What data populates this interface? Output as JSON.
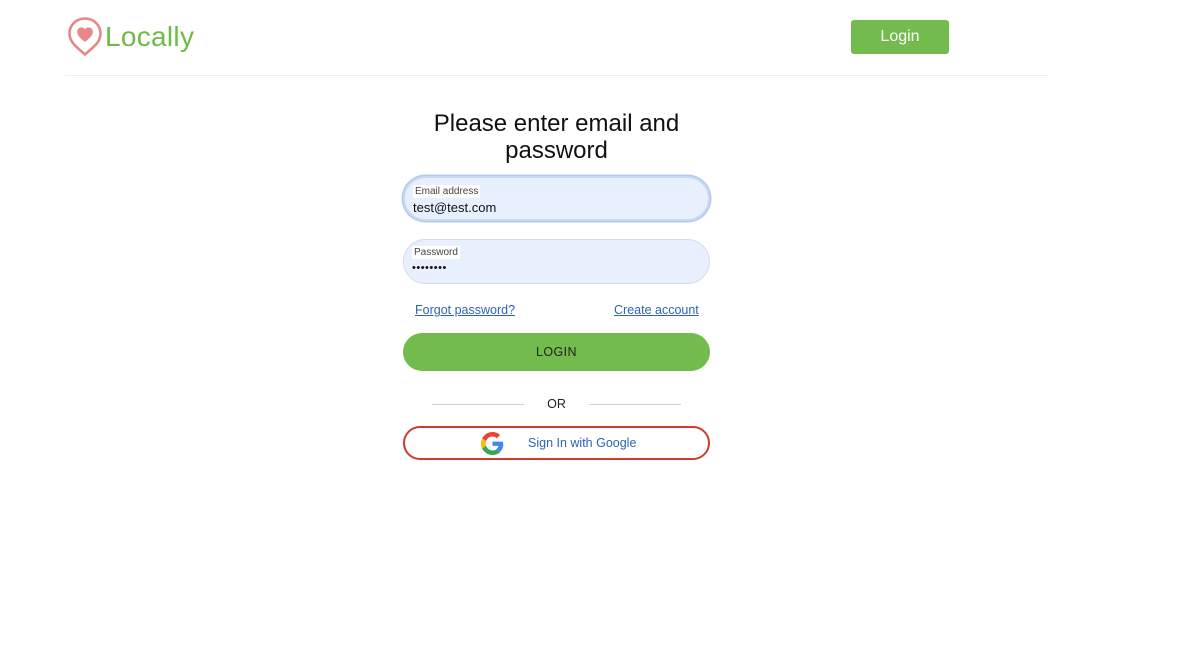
{
  "header": {
    "brand": "Locally",
    "login_label": "Login"
  },
  "form": {
    "heading": "Please enter email and password",
    "email": {
      "label": "Email address",
      "value": "test@test.com"
    },
    "password": {
      "label": "Password",
      "value": "••••••••"
    },
    "forgot_label": "Forgot password?",
    "create_label": "Create account",
    "submit_label": "LOGIN",
    "or_label": "OR",
    "google_label": "Sign In with Google"
  },
  "colors": {
    "brand_green": "#72bb4c",
    "logo_pink": "#e8868a",
    "link_blue": "#2e63b8",
    "google_border": "#d23a2e"
  },
  "icons": {
    "logo": "heart-pin-icon",
    "google": "google-g-icon"
  }
}
